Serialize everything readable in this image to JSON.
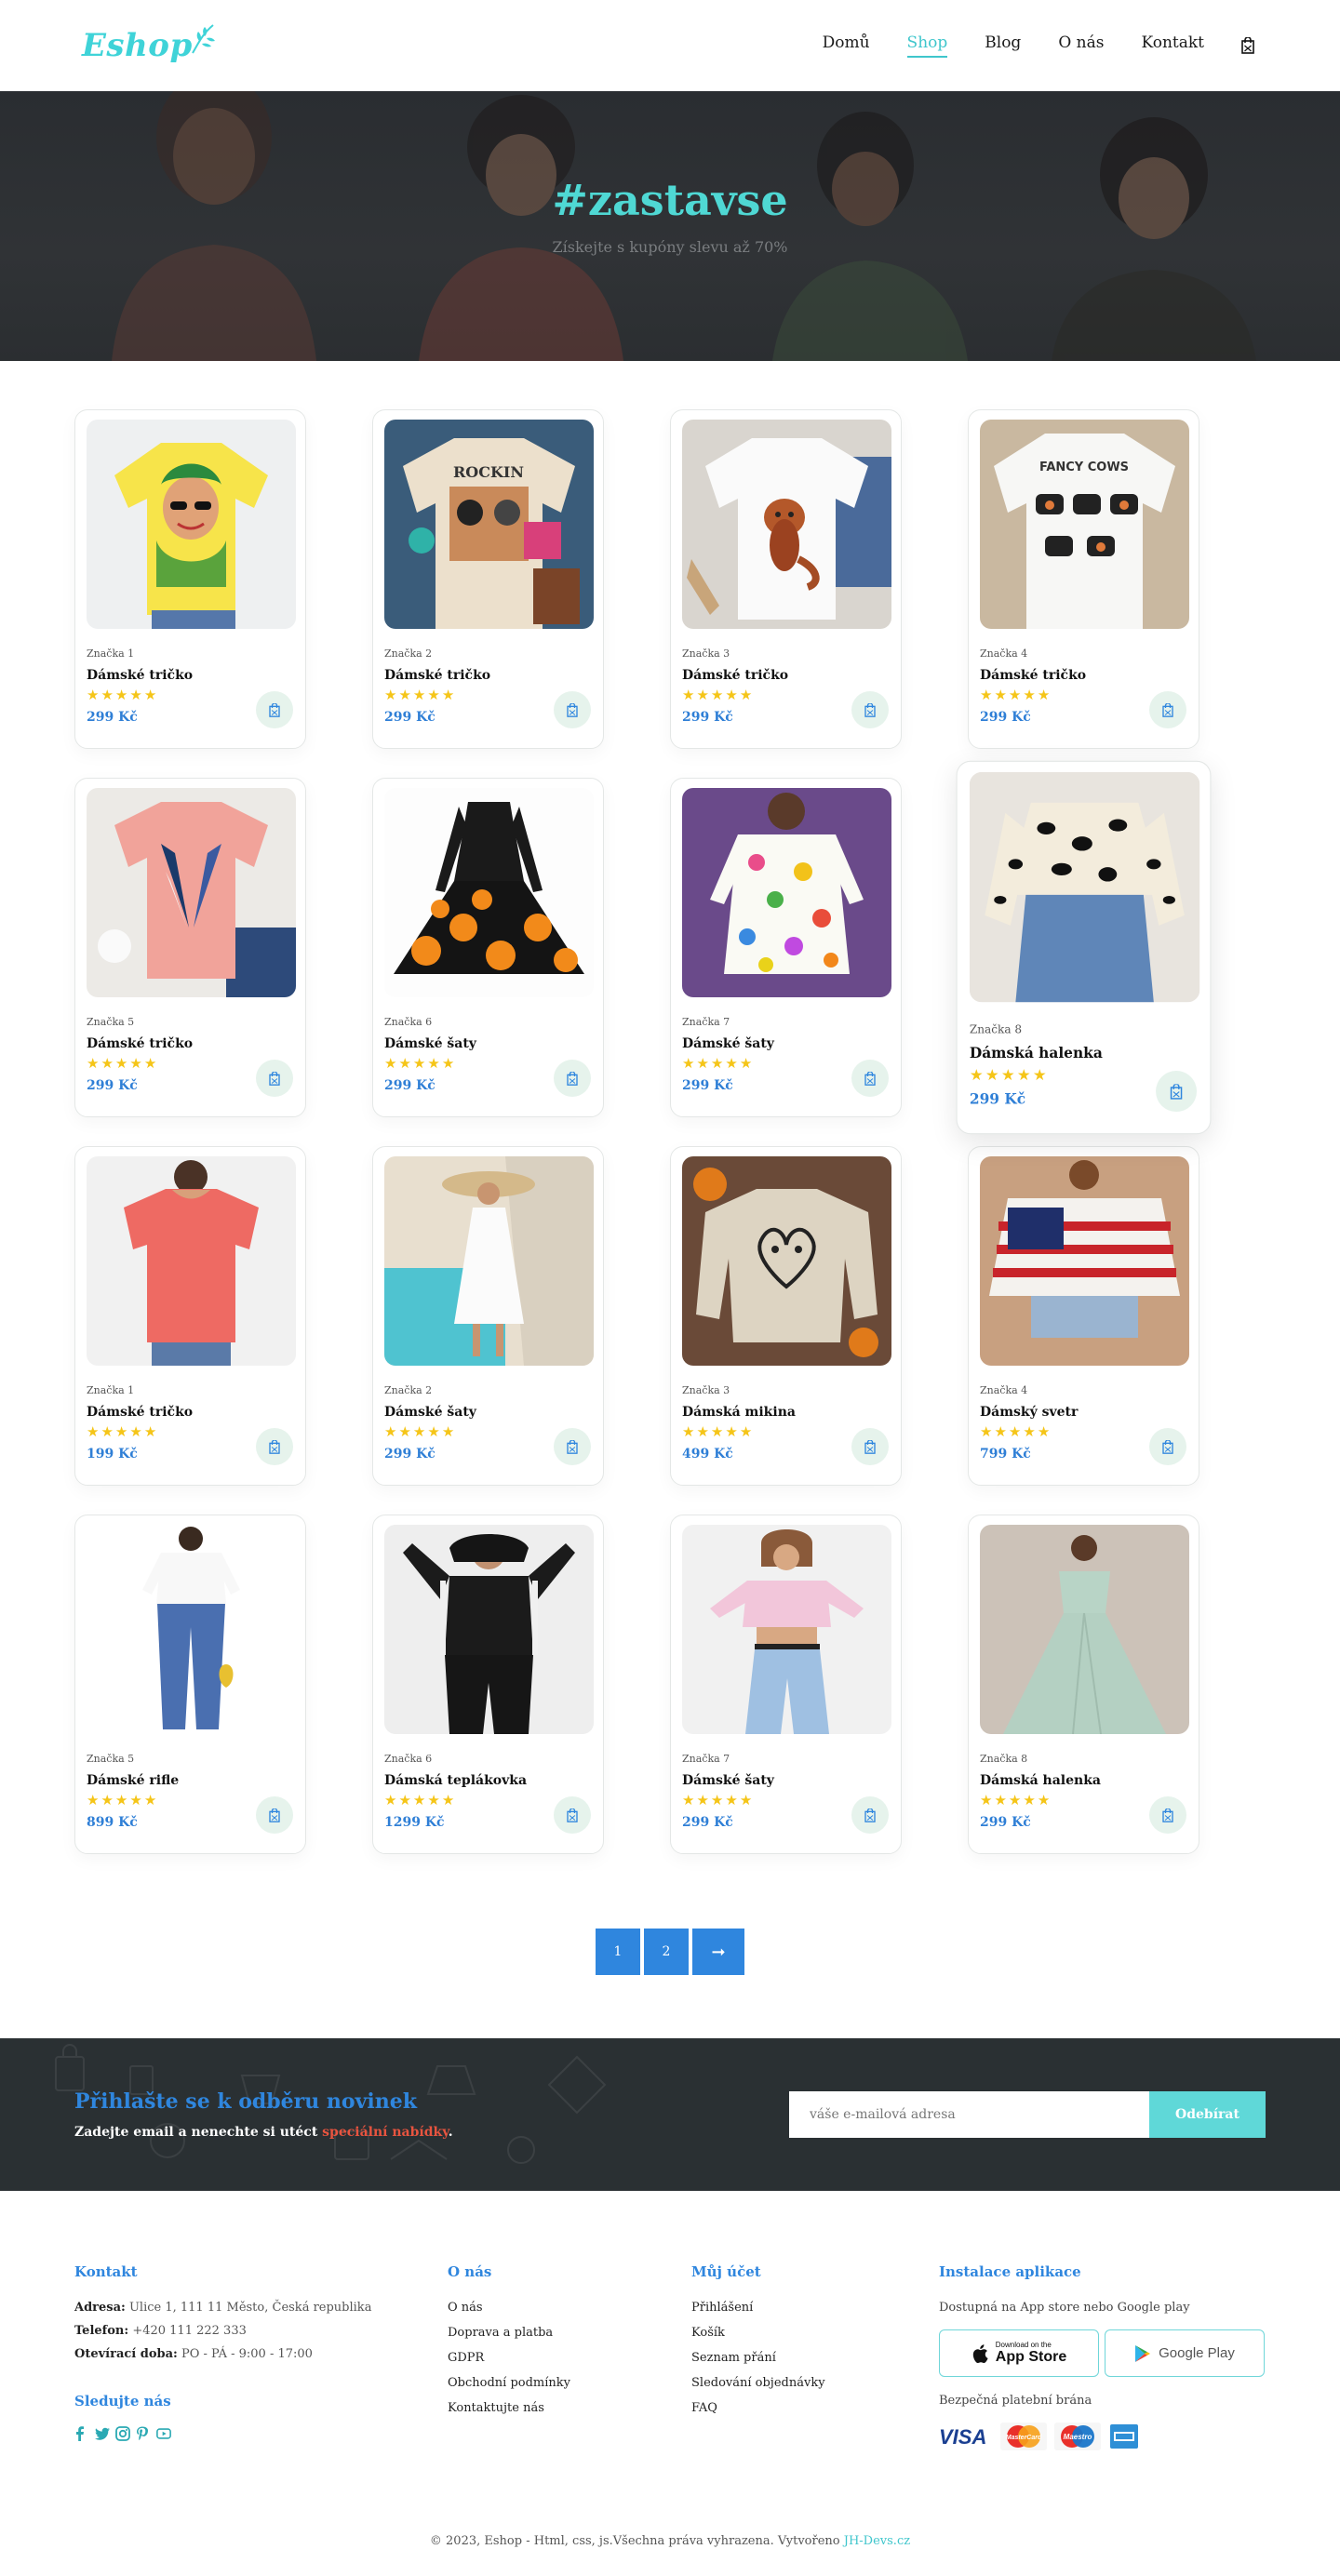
{
  "header": {
    "logo_text": "Eshop",
    "nav": [
      {
        "label": "Domů",
        "active": false
      },
      {
        "label": "Shop",
        "active": true
      },
      {
        "label": "Blog",
        "active": false
      },
      {
        "label": "O nás",
        "active": false
      },
      {
        "label": "Kontakt",
        "active": false
      }
    ],
    "cart_icon": "cart-icon"
  },
  "hero": {
    "title": "#zastavse",
    "subtitle": "Získejte s kupóny slevu až 70%"
  },
  "products": [
    {
      "brand": "Značka 1",
      "name": "Dámské tričko",
      "rating": 5,
      "price": "299 Kč",
      "image": "yellow-tshirt-woman-print"
    },
    {
      "brand": "Značka 2",
      "name": "Dámské tričko",
      "rating": 5,
      "price": "299 Kč",
      "image": "beige-band-tshirt"
    },
    {
      "brand": "Značka 3",
      "name": "Dámské tričko",
      "rating": 5,
      "price": "299 Kč",
      "image": "white-tshirt-red-panda"
    },
    {
      "brand": "Značka 4",
      "name": "Dámské tričko",
      "rating": 5,
      "price": "299 Kč",
      "image": "white-tshirt-cows"
    },
    {
      "brand": "Značka 5",
      "name": "Dámské tričko",
      "rating": 5,
      "price": "299 Kč",
      "image": "pink-tshirt-wings"
    },
    {
      "brand": "Značka 6",
      "name": "Dámské šaty",
      "rating": 5,
      "price": "299 Kč",
      "image": "pumpkin-dress"
    },
    {
      "brand": "Značka 7",
      "name": "Dámské šaty",
      "rating": 5,
      "price": "299 Kč",
      "image": "floral-dress"
    },
    {
      "brand": "Značka 8",
      "name": "Dámská halenka",
      "rating": 5,
      "price": "299 Kč",
      "image": "leopard-blouse",
      "featured": true
    },
    {
      "brand": "Značka 1",
      "name": "Dámské tričko",
      "rating": 5,
      "price": "199 Kč",
      "image": "coral-tshirt"
    },
    {
      "brand": "Značka 2",
      "name": "Dámské šaty",
      "rating": 5,
      "price": "299 Kč",
      "image": "white-beach-dress"
    },
    {
      "brand": "Značka 3",
      "name": "Dámská mikina",
      "rating": 5,
      "price": "499 Kč",
      "image": "beige-sweatshirt"
    },
    {
      "brand": "Značka 4",
      "name": "Dámský svetr",
      "rating": 5,
      "price": "799 Kč",
      "image": "flag-sweater"
    },
    {
      "brand": "Značka 5",
      "name": "Dámské rifle",
      "rating": 5,
      "price": "899 Kč",
      "image": "blue-jeans"
    },
    {
      "brand": "Značka 6",
      "name": "Dámská teplákovka",
      "rating": 5,
      "price": "1299 Kč",
      "image": "black-tracksuit"
    },
    {
      "brand": "Značka 7",
      "name": "Dámské šaty",
      "rating": 5,
      "price": "299 Kč",
      "image": "pink-top-jeans"
    },
    {
      "brand": "Značka 8",
      "name": "Dámská halenka",
      "rating": 5,
      "price": "299 Kč",
      "image": "mint-gown"
    }
  ],
  "pagination": {
    "pages": [
      "1",
      "2"
    ],
    "next_label": "➞"
  },
  "newsletter": {
    "title": "Přihlašte se k odběru novinek",
    "desc_before": "Zadejte email a nenechte si utéct ",
    "desc_highlight": "speciální nabídky",
    "desc_after": ".",
    "placeholder": "váše e-mailová adresa",
    "button": "Odebírat"
  },
  "footer": {
    "contact": {
      "heading": "Kontakt",
      "address_label": "Adresa:",
      "address": " Ulice 1, 111 11 Město, Česká republika",
      "phone_label": "Telefon:",
      "phone": " +420 111 222 333",
      "hours_label": "Otevírací doba:",
      "hours": " PO - PÁ - 9:00 - 17:00",
      "follow_heading": "Sledujte nás"
    },
    "about": {
      "heading": "O nás",
      "links": [
        "O nás",
        "Doprava a platba",
        "GDPR",
        "Obchodní podmínky",
        "Kontaktujte nás"
      ]
    },
    "account": {
      "heading": "Můj účet",
      "links": [
        "Přihlášení",
        "Košík",
        "Seznam přání",
        "Sledování objednávky",
        "FAQ"
      ]
    },
    "app": {
      "heading": "Instalace aplikace",
      "desc": "Dostupná na App store nebo Google play",
      "appstore_small": "Download on the",
      "appstore_big": "App Store",
      "googleplay": "Google Play",
      "payment_label": "Bezpečná platební brána",
      "visa": "VISA",
      "mastercard": "MasterCard",
      "maestro": "Maestro"
    }
  },
  "copyright": {
    "text": "© 2023, Eshop - Html, css, js.Všechna práva vyhrazena. Vytvořeno ",
    "link": "JH-Devs.cz"
  },
  "colors": {
    "accent_teal": "#3fd3d8",
    "accent_blue": "#2f86de",
    "star": "#f5c518",
    "cart_bubble": "#e6f3ec",
    "newsletter_bg": "#2a3033"
  }
}
